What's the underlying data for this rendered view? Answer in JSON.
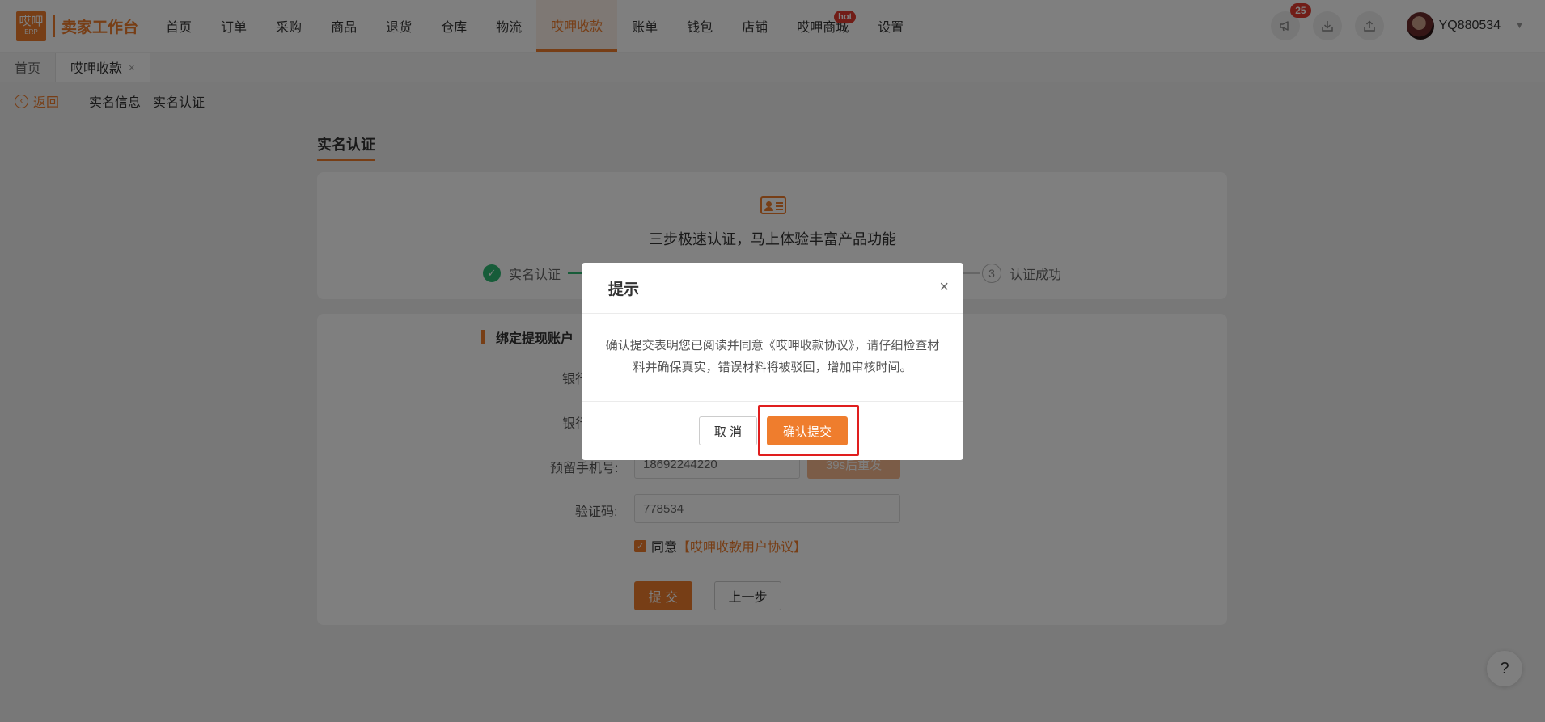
{
  "header": {
    "logo_main": "哎呷",
    "logo_sub": "ERP",
    "app_title": "卖家工作台",
    "nav": [
      {
        "label": "首页"
      },
      {
        "label": "订单"
      },
      {
        "label": "采购"
      },
      {
        "label": "商品"
      },
      {
        "label": "退货"
      },
      {
        "label": "仓库"
      },
      {
        "label": "物流"
      },
      {
        "label": "哎呷收款",
        "active": true
      },
      {
        "label": "账单"
      },
      {
        "label": "钱包"
      },
      {
        "label": "店铺"
      },
      {
        "label": "哎呷商城",
        "badge": "hot"
      },
      {
        "label": "设置"
      }
    ],
    "notification_count": "25",
    "username": "YQ880534",
    "icons": [
      "megaphone-icon",
      "download-icon",
      "upload-icon",
      "chevron-down-icon"
    ]
  },
  "tabs": [
    {
      "label": "首页"
    },
    {
      "label": "哎呷收款",
      "close": "×",
      "active": true
    }
  ],
  "breadcrumb": {
    "back_label": "返回",
    "items": [
      "实名信息",
      "实名认证"
    ]
  },
  "page": {
    "title": "实名认证",
    "slogan": "三步极速认证，马上体验丰富产品功能",
    "steps": [
      {
        "label": "实名认证",
        "state": "done"
      },
      {
        "number": "3",
        "label": "认证成功",
        "state": "pending"
      }
    ]
  },
  "form": {
    "section_title": "绑定提现账户",
    "bank_label_1": "银行",
    "bank_label_2": "银行",
    "phone_label": "预留手机号:",
    "phone_value": "18692244220",
    "resend_label": "39s后重发",
    "code_label": "验证码:",
    "code_value": "778534",
    "agree_text": "同意",
    "agree_link": "【哎呷收款用户协议】",
    "submit_label": "提 交",
    "prev_label": "上一步"
  },
  "help_label": "?",
  "modal": {
    "title": "提示",
    "close": "×",
    "message": "确认提交表明您已阅读并同意《哎呷收款协议》，请仔细检查材料并确保真实，错误材料将被驳回，增加审核时间。",
    "cancel_label": "取 消",
    "confirm_label": "确认提交"
  },
  "colors": {
    "accent": "#ef7d2d",
    "success": "#2fb873",
    "badge": "#e23b2e",
    "highlight": "#e01e1e"
  }
}
